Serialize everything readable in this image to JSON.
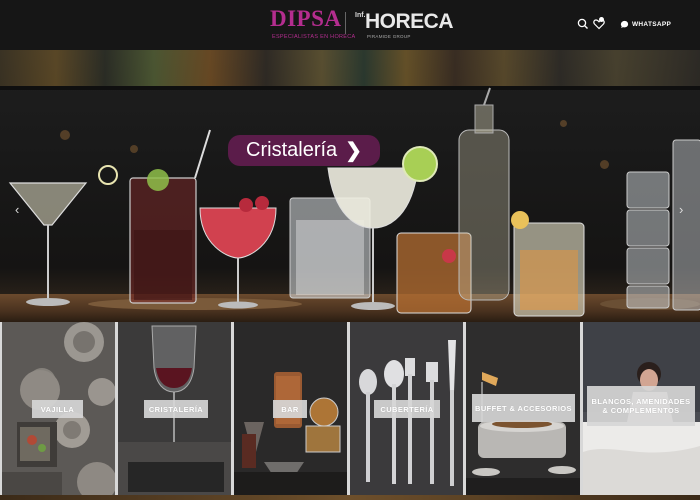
{
  "header": {
    "logo_dipsa": {
      "name": "DIPSA",
      "tagline": "ESPECIALISTAS EN HORECA"
    },
    "logo_horeca": {
      "prefix": "Inf.",
      "name": "HORECA",
      "sub": "PIRAMIDE GROUP"
    },
    "whatsapp_label": "WHATSAPP",
    "brand_color": "#b42d8f"
  },
  "hero": {
    "cta_label": "Cristalería",
    "cta_color": "#5b1c4a"
  },
  "categories": [
    {
      "label": "VAJILLA"
    },
    {
      "label": "CRISTALERÍA"
    },
    {
      "label": "BAR"
    },
    {
      "label": "CUBERTERÍA"
    },
    {
      "label": "BUFFET & ACCESORIOS"
    },
    {
      "label": "BLANCOS, AMENIDADES & COMPLEMENTOS"
    }
  ]
}
